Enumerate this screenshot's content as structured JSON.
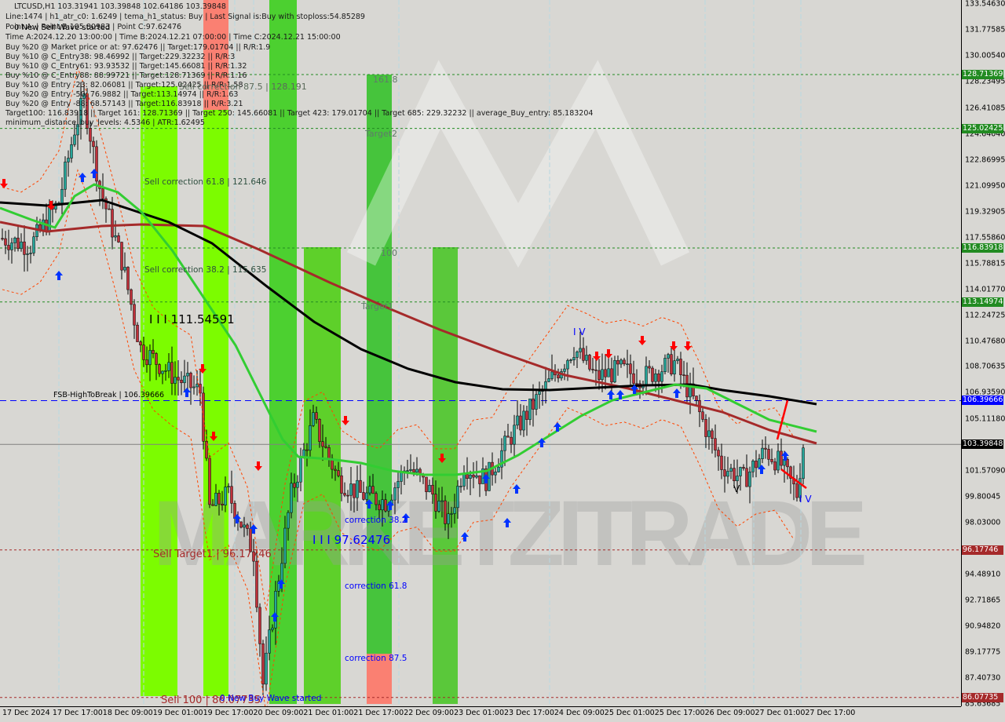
{
  "header": {
    "symbol_line": "LTCUSD,H1  103.31941 103.39848 102.64186 103.39848",
    "info_lines": [
      "Line:1474 | h1_atr_c0: 1.6249 | tema_h1_status: Buy | Last Signal is:Buy with stoploss:54.85289",
      "Point A: | Point B:105.80983 | Point C:97.62476",
      "Time A:2024.12.20 13:00:00 | Time B:2024.12.21 07:00:00 | Time C:2024.12.21 15:00:00",
      "Buy %20 @ Market price or at: 97.62476 || Target:179.01704 || R/R:1.9",
      "Buy %10 @ C_Entry38: 98.46992 || Target:229.32232 || R/R:3",
      "Buy %10 @ C_Entry61: 93.93532 || Target:145.66081 || R/R:1.32",
      "Buy %10 @ C_Entry88: 88.99721 || Target:128.71369 || R/R:1.16",
      "Buy %10 @ Entry -23: 82.06081 || Target:125.02425 || R/R:1.58",
      "Buy %20 @ Entry -50: 76.9882 || Target:113.14974 || R/R:1.63",
      "Buy %20 @ Entry -88: 68.57143 || Target:116.83918 || R/R:3.21",
      "Target100: 116.83918 || Target 161: 128.71369 || Target 250: 145.66081 || Target 423: 179.01704 || Target 685: 229.32232 || average_Buy_entry: 85.183204",
      "minimum_distance_buy_levels: 4.5346 | ATR:1.62495"
    ],
    "sell_wave_label": "0 New Sell Wave started"
  },
  "annotations": {
    "sell_corr_875": "Sell correction 87.5 | 128.191",
    "sell_corr_618": "Sell correction 61.8 | 121.646",
    "sell_corr_382": "Sell correction 38.2 | 115.635",
    "wave_level_1": "I I I 111.54591",
    "fsb": "FSB-HighToBreak | 106.39666",
    "sell_target1": "Sell Target1 | 96.17746",
    "sell_100": "Sell 100 | 86.07735",
    "buy_wave": "0 New Buy Wave started",
    "wave_level_2": "I I I 97.62476",
    "corr_382": "correction 38.2",
    "corr_618": "correction 61.8",
    "corr_875": "correction 87.5",
    "t1618": "161.8",
    "target2": "Target2",
    "t100": "100",
    "target1": "Target1",
    "iv1": "I V",
    "v": "V",
    "iv2": "I V",
    "watermark": "MARKETZITRADE"
  },
  "colors": {
    "background": "#d8d7d3",
    "bull_candle": "#26a69a",
    "bear_candle": "#c0303a",
    "ma_black": "#000000",
    "ma_red": "#a52a2a",
    "ma_green": "#32cd32",
    "band_light_green": "#7cfc00",
    "band_green": "#3cc43c",
    "band_red": "#fa8072",
    "target_line": "#228b22",
    "fsb_line": "#0000ff",
    "sell_line": "#a52a2a"
  },
  "chart_data": {
    "type": "candlestick",
    "symbol": "LTCUSD",
    "timeframe": "H1",
    "ylim": [
      85.63685,
      133.5463
    ],
    "y_ticks": [
      "133.54630",
      "131.77585",
      "130.00540",
      "128.23495",
      "126.41085",
      "124.64040",
      "122.86995",
      "121.09950",
      "119.32905",
      "117.55860",
      "115.78815",
      "114.01770",
      "112.24725",
      "110.47680",
      "108.70635",
      "106.93590",
      "105.11180",
      "101.57090",
      "99.80045",
      "98.03000",
      "94.48910",
      "92.71865",
      "90.94820",
      "89.17775",
      "87.40730",
      "85.63685"
    ],
    "x_ticks": [
      "17 Dec 2024",
      "17 Dec 17:00",
      "18 Dec 09:00",
      "19 Dec 01:00",
      "19 Dec 17:00",
      "20 Dec 09:00",
      "21 Dec 01:00",
      "21 Dec 17:00",
      "22 Dec 09:00",
      "23 Dec 01:00",
      "23 Dec 17:00",
      "24 Dec 09:00",
      "25 Dec 01:00",
      "25 Dec 17:00",
      "26 Dec 09:00",
      "27 Dec 01:00",
      "27 Dec 17:00"
    ],
    "levels": [
      {
        "value": 128.71369,
        "label": "128.71369",
        "kind": "target",
        "color": "#228b22"
      },
      {
        "value": 125.02425,
        "label": "125.02425",
        "kind": "target",
        "color": "#228b22"
      },
      {
        "value": 116.83918,
        "label": "116.83918",
        "kind": "target",
        "color": "#228b22"
      },
      {
        "value": 113.14974,
        "label": "113.14974",
        "kind": "target",
        "color": "#228b22"
      },
      {
        "value": 106.39666,
        "label": "106.39666",
        "kind": "fsb",
        "color": "#0000ff"
      },
      {
        "value": 103.39848,
        "label": "103.39848",
        "kind": "current",
        "color": "#000000"
      },
      {
        "value": 96.17746,
        "label": "96.17746",
        "kind": "sell",
        "color": "#a52a2a"
      },
      {
        "value": 86.07735,
        "label": "86.07735",
        "kind": "sell",
        "color": "#a52a2a"
      }
    ],
    "price_path": [
      [
        "17 Dec 01:00",
        117.5
      ],
      [
        "17 Dec 10:00",
        117
      ],
      [
        "17 Dec 19:00",
        120
      ],
      [
        "18 Dec 00:00",
        125
      ],
      [
        "18 Dec 03:00",
        127
      ],
      [
        "18 Dec 08:00",
        121
      ],
      [
        "18 Dec 15:00",
        116
      ],
      [
        "18 Dec 21:00",
        110
      ],
      [
        "19 Dec 08:00",
        108
      ],
      [
        "19 Dec 16:00",
        107
      ],
      [
        "19 Dec 19:00",
        99
      ],
      [
        "20 Dec 01:00",
        100
      ],
      [
        "20 Dec 09:00",
        96
      ],
      [
        "20 Dec 12:00",
        87
      ],
      [
        "20 Dec 16:00",
        93
      ],
      [
        "20 Dec 21:00",
        100
      ],
      [
        "21 Dec 04:00",
        105
      ],
      [
        "21 Dec 12:00",
        101
      ],
      [
        "21 Dec 19:00",
        100
      ],
      [
        "22 Dec 03:00",
        99.5
      ],
      [
        "22 Dec 10:00",
        102
      ],
      [
        "22 Dec 18:00",
        100
      ],
      [
        "22 Dec 23:00",
        98
      ],
      [
        "23 Dec 04:00",
        102
      ],
      [
        "23 Dec 11:00",
        101
      ],
      [
        "23 Dec 19:00",
        104
      ],
      [
        "24 Dec 05:00",
        107
      ],
      [
        "24 Dec 15:00",
        110
      ],
      [
        "24 Dec 22:00",
        108
      ],
      [
        "25 Dec 06:00",
        108.5
      ],
      [
        "25 Dec 13:00",
        108
      ],
      [
        "25 Dec 23:00",
        109
      ],
      [
        "26 Dec 06:00",
        106
      ],
      [
        "26 Dec 14:00",
        102
      ],
      [
        "26 Dec 21:00",
        101
      ],
      [
        "27 Dec 04:00",
        103
      ],
      [
        "27 Dec 09:00",
        102
      ],
      [
        "27 Dec 14:00",
        100
      ],
      [
        "27 Dec 16:00",
        103.4
      ]
    ]
  }
}
